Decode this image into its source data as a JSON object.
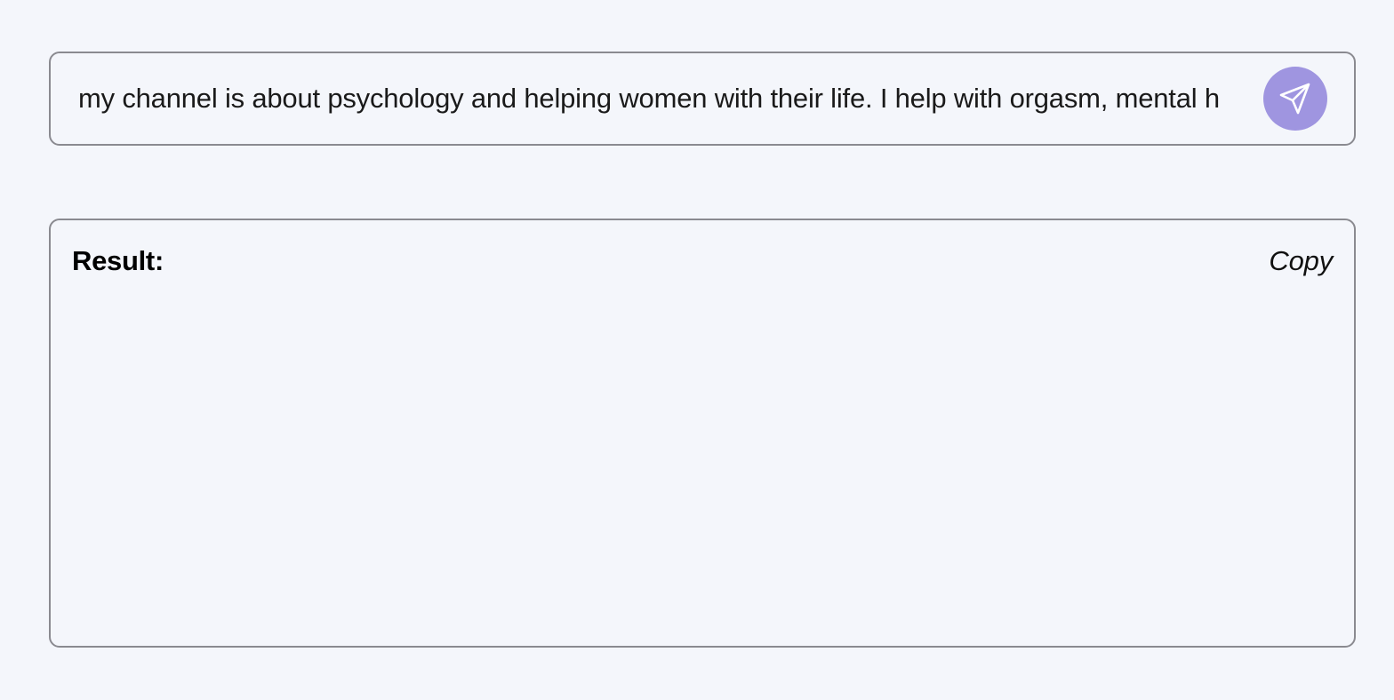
{
  "prompt": {
    "value": "my channel is about psychology and helping women with their life. I help with orgasm, mental h",
    "send_icon": "send-paper-plane-icon",
    "send_button_color": "#9f95e0"
  },
  "result": {
    "label": "Result:",
    "copy_label": "Copy",
    "content": ""
  },
  "colors": {
    "background": "#f4f6fb",
    "border": "#8a8a90",
    "accent": "#9f95e0"
  }
}
